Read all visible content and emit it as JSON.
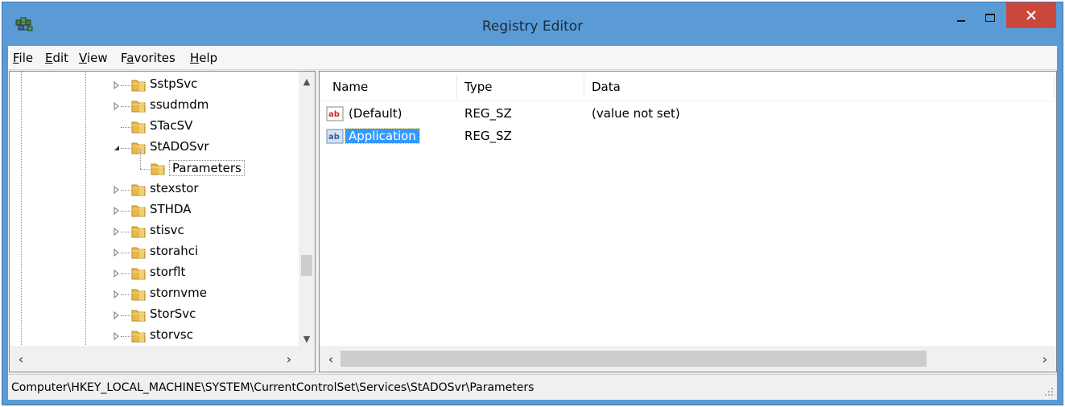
{
  "window": {
    "title": "Registry Editor"
  },
  "menu": {
    "items": [
      {
        "label": "File",
        "key": "F",
        "rest": "ile"
      },
      {
        "label": "Edit",
        "key": "E",
        "rest": "dit"
      },
      {
        "label": "View",
        "key": "V",
        "rest": "iew"
      },
      {
        "label": "Favorites",
        "key": "a",
        "pre": "F",
        "rest": "vorites"
      },
      {
        "label": "Help",
        "key": "H",
        "rest": "elp"
      }
    ]
  },
  "tree": {
    "items": [
      {
        "label": "SstpSvc",
        "expander": "collapsed",
        "level": 0
      },
      {
        "label": "ssudmdm",
        "expander": "collapsed",
        "level": 0
      },
      {
        "label": "STacSV",
        "expander": "none",
        "level": 0
      },
      {
        "label": "StADOSvr",
        "expander": "expanded",
        "level": 0
      },
      {
        "label": "Parameters",
        "expander": "none",
        "level": 1,
        "selected": true
      },
      {
        "label": "stexstor",
        "expander": "collapsed",
        "level": 0
      },
      {
        "label": "STHDA",
        "expander": "collapsed",
        "level": 0
      },
      {
        "label": "stisvc",
        "expander": "collapsed",
        "level": 0
      },
      {
        "label": "storahci",
        "expander": "collapsed",
        "level": 0
      },
      {
        "label": "storflt",
        "expander": "collapsed",
        "level": 0
      },
      {
        "label": "stornvme",
        "expander": "collapsed",
        "level": 0
      },
      {
        "label": "StorSvc",
        "expander": "collapsed",
        "level": 0
      },
      {
        "label": "storvsc",
        "expander": "collapsed",
        "level": 0
      }
    ]
  },
  "list": {
    "columns": [
      "Name",
      "Type",
      "Data"
    ],
    "rows": [
      {
        "name": "(Default)",
        "type": "REG_SZ",
        "data": "(value not set)",
        "selected": false
      },
      {
        "name": "Application",
        "type": "REG_SZ",
        "data": "",
        "selected": true
      }
    ]
  },
  "status": {
    "path": "Computer\\HKEY_LOCAL_MACHINE\\SYSTEM\\CurrentControlSet\\Services\\StADOSvr\\Parameters"
  },
  "colors": {
    "titlebar": "#5b9bd5",
    "close": "#c9473b",
    "selection": "#3399ff",
    "folder": "#e8b84a"
  }
}
